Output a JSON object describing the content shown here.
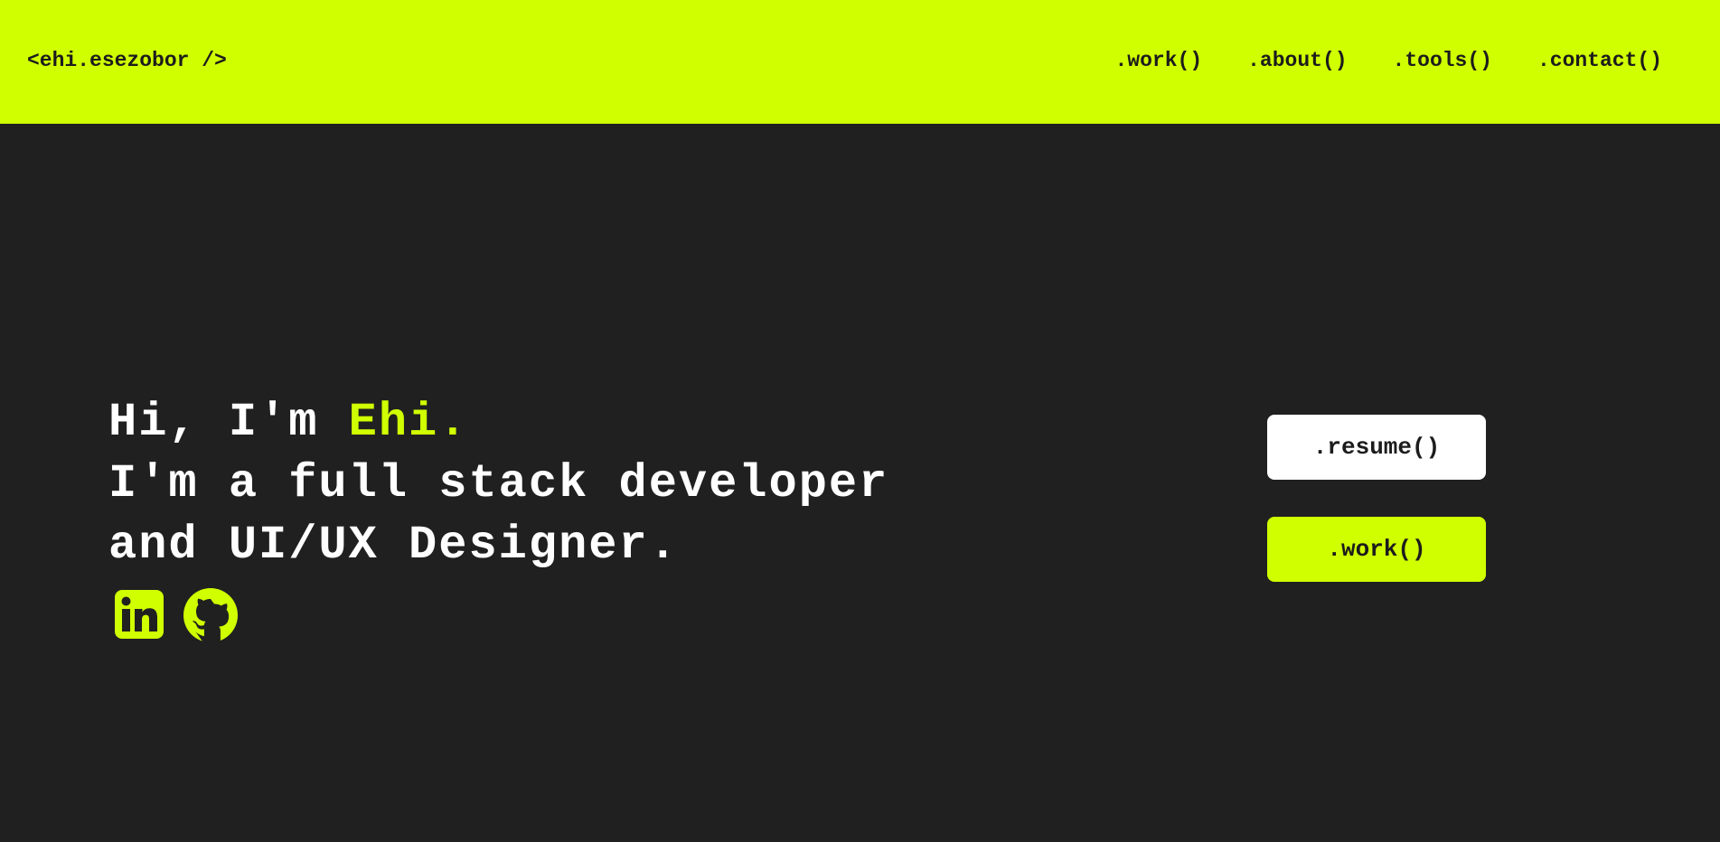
{
  "header": {
    "logo": "<ehi.esezobor />",
    "nav": [
      {
        "label": ".work()"
      },
      {
        "label": ".about()"
      },
      {
        "label": ".tools()"
      },
      {
        "label": ".contact()"
      }
    ]
  },
  "hero": {
    "greeting_prefix": "Hi, I'm ",
    "name": "Ehi.",
    "line2": "I'm a full stack developer",
    "line3": "and UI/UX Designer."
  },
  "socials": [
    {
      "icon": "linkedin-icon"
    },
    {
      "icon": "github-icon"
    }
  ],
  "actions": {
    "resume_label": ".resume()",
    "work_label": ".work()"
  },
  "colors": {
    "accent": "#d0ff00",
    "background": "#202020",
    "text": "#ffffff"
  }
}
